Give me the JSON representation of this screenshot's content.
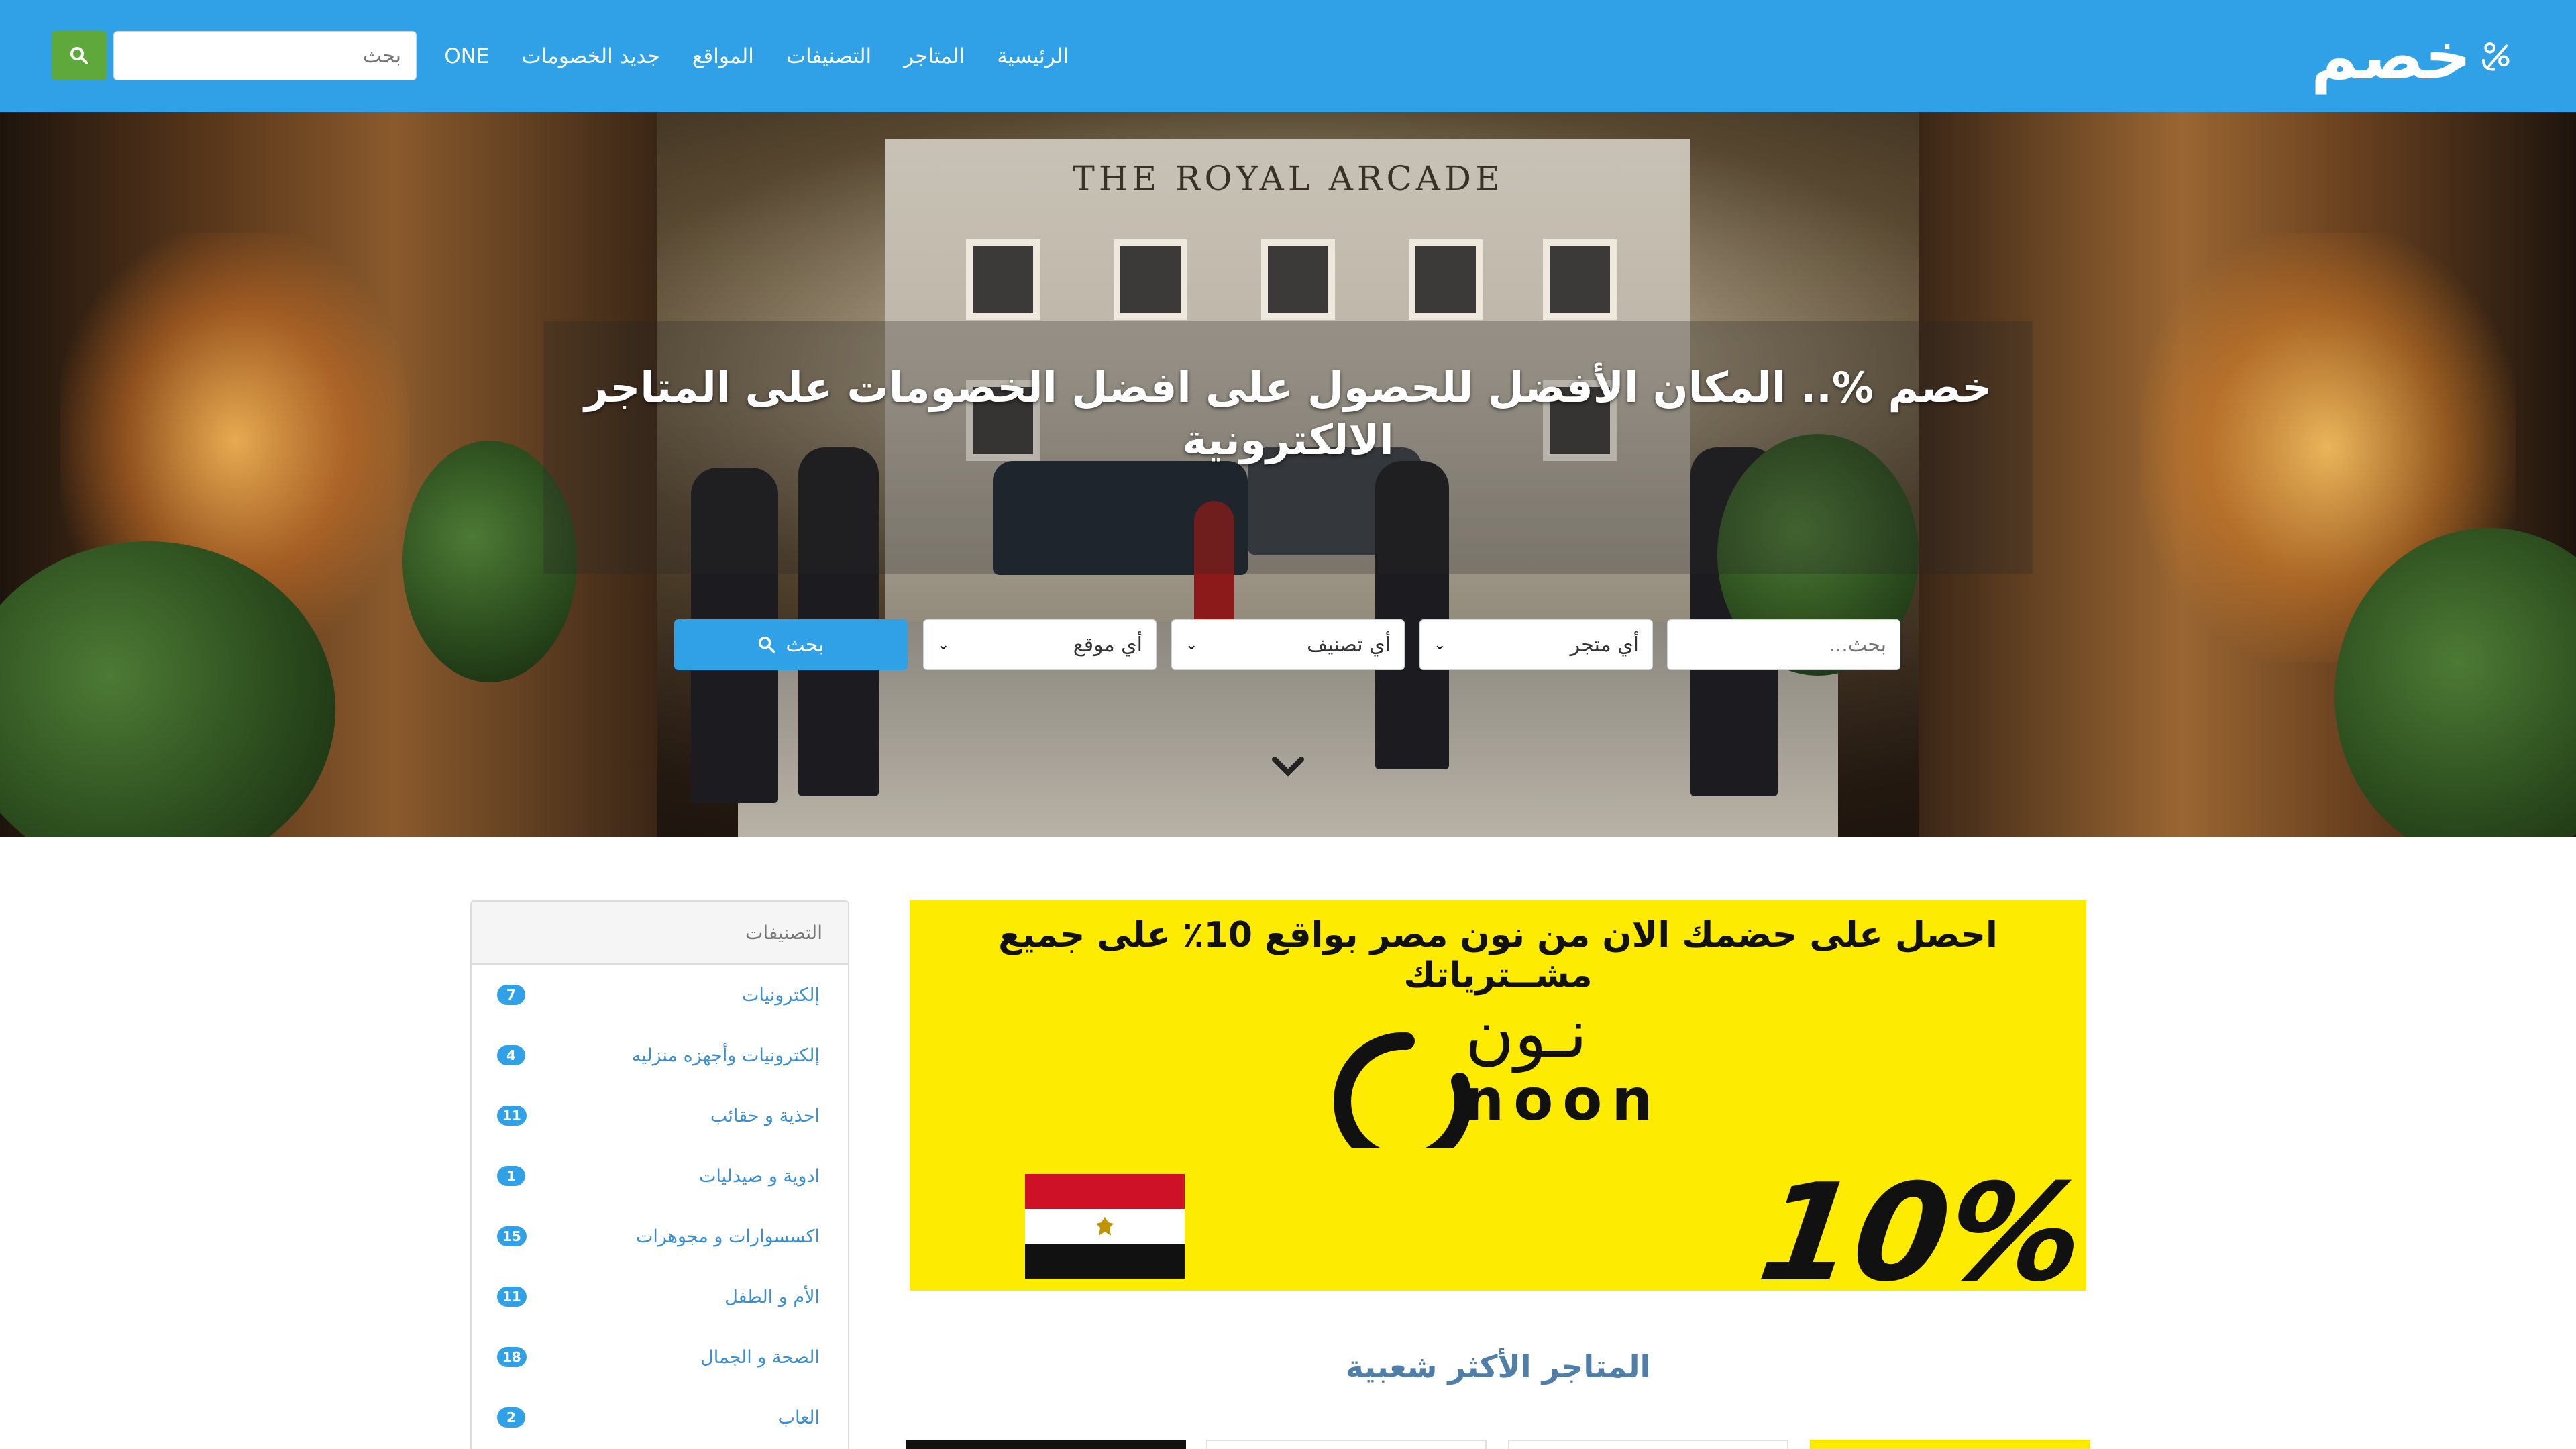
{
  "nav": {
    "logo_text": "خصم",
    "menu": [
      "الرئيسية",
      "المتاجر",
      "التصنيفات",
      "المواقع",
      "جديد الخصومات",
      "ONE"
    ],
    "search_placeholder": "بحث",
    "search_icon": "search-icon",
    "colors": {
      "bar": "#30a1e6",
      "search_button": "#5fa83b"
    }
  },
  "hero": {
    "title": "خصم %.. المكان الأفضل للحصول على افضل الخصومات على المتاجر الالكترونية",
    "search_placeholder": "بحث...",
    "store_select": "أي متجر",
    "category_select": "أي تصنيف",
    "location_select": "أي موقع",
    "search_button": "بحث",
    "photo_sign": "THE ROYAL ARCADE",
    "scroll_icon": "chevron-down-icon"
  },
  "sidebar": {
    "title": "التصنيفات",
    "items": [
      {
        "label": "إلكترونيات",
        "count": "7"
      },
      {
        "label": "إلكترونيات وأجهزه منزليه",
        "count": "4"
      },
      {
        "label": "احذية و حقائب",
        "count": "11"
      },
      {
        "label": "ادوية و صيدليات",
        "count": "1"
      },
      {
        "label": "اكسسوارات و مجوهرات",
        "count": "15"
      },
      {
        "label": "الأم و الطفل",
        "count": "11"
      },
      {
        "label": "الصحة و الجمال",
        "count": "18"
      },
      {
        "label": "العاب",
        "count": "2"
      }
    ]
  },
  "banner": {
    "headline": "احصل على حضمك الان من نون مصر بواقع 10٪ على جميع مشــترياتك",
    "brand_arabic": "نـون",
    "brand_latin": "noon",
    "percent": "10%",
    "background": "#fdeb01",
    "flag_icon": "egypt-flag-icon"
  },
  "section": {
    "title": "المتاجر الأكثر شعبية"
  }
}
